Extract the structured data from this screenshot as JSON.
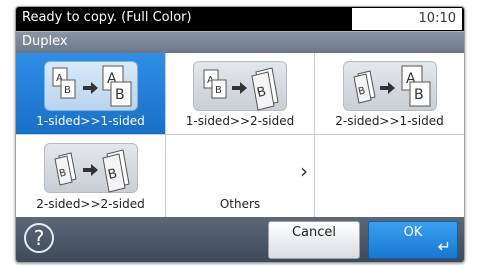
{
  "status": {
    "message": "Ready to copy. (Full Color)",
    "time": "10:10"
  },
  "screen": {
    "title": "Duplex"
  },
  "options": [
    {
      "label": "1-sided>>1-sided",
      "selected": true,
      "icon": "one-sided-to-one-sided-icon"
    },
    {
      "label": "1-sided>>2-sided",
      "selected": false,
      "icon": "one-sided-to-two-sided-icon"
    },
    {
      "label": "2-sided>>1-sided",
      "selected": false,
      "icon": "two-sided-to-one-sided-icon"
    },
    {
      "label": "2-sided>>2-sided",
      "selected": false,
      "icon": "two-sided-to-two-sided-icon"
    },
    {
      "label": "Others",
      "selected": false,
      "icon": "chevron-right-icon"
    }
  ],
  "footer": {
    "help_label": "?",
    "cancel_label": "Cancel",
    "ok_label": "OK"
  },
  "colors": {
    "accent": "#1a6fc7",
    "statusbar": "#000000",
    "titlebar": "#6b7787"
  }
}
